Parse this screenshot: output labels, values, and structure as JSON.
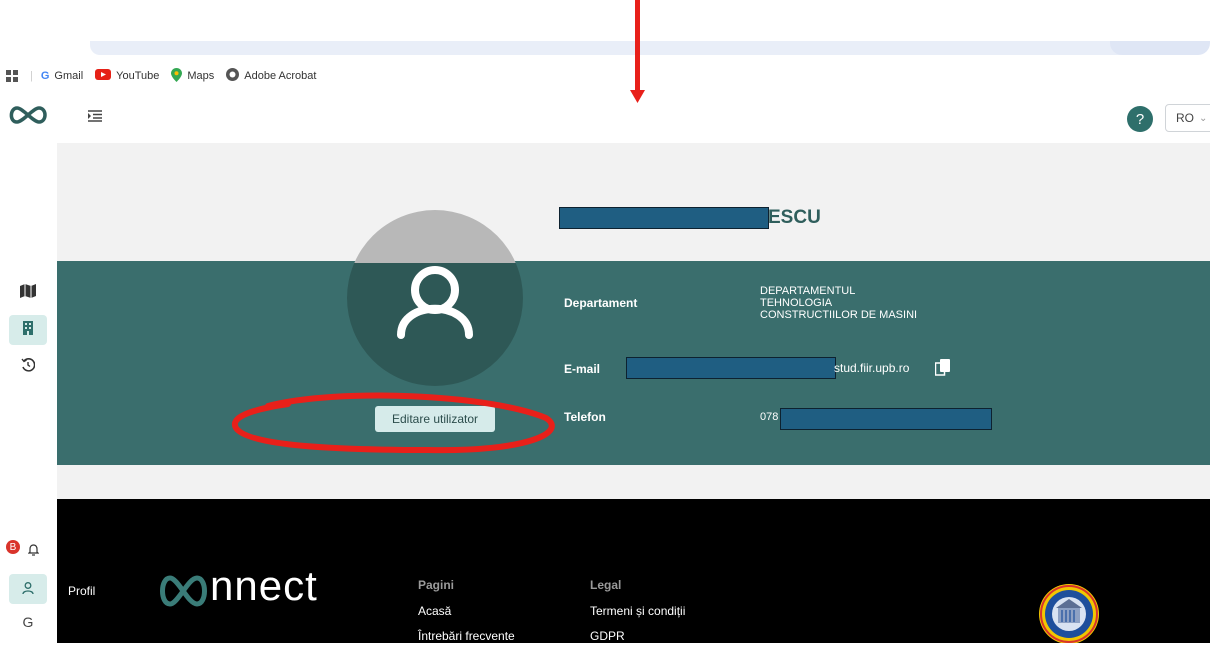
{
  "browser": {
    "bookmarks": [
      {
        "label": "Gmail",
        "icon": "google-icon"
      },
      {
        "label": "YouTube",
        "icon": "youtube-icon"
      },
      {
        "label": "Maps",
        "icon": "maps-icon"
      },
      {
        "label": "Adobe Acrobat",
        "icon": "acrobat-icon"
      }
    ]
  },
  "header": {
    "help_label": "?",
    "language": "RO"
  },
  "profile": {
    "name_suffix": "ESCU",
    "edit_button": "Editare utilizator",
    "department_label": "Departament",
    "department_lines": [
      "DEPARTAMENTUL",
      "TEHNOLOGIA",
      "CONSTRUCTIILOR DE MASINI"
    ],
    "email_label": "E-mail",
    "email_suffix": "stud.fiir.upb.ro",
    "phone_label": "Telefon",
    "phone_prefix": "078"
  },
  "footer": {
    "profile_link": "Profil",
    "brand": "nnect",
    "pages_heading": "Pagini",
    "pages": [
      "Acasă",
      "Întrebări frecvente"
    ],
    "legal_heading": "Legal",
    "legal": [
      "Termeni și condiții",
      "GDPR"
    ]
  },
  "sidebar": {
    "notification_badge": "B"
  },
  "colors": {
    "teal": "#3a6e6d",
    "accent": "#2e6f6b",
    "annotation": "#e8201a"
  }
}
